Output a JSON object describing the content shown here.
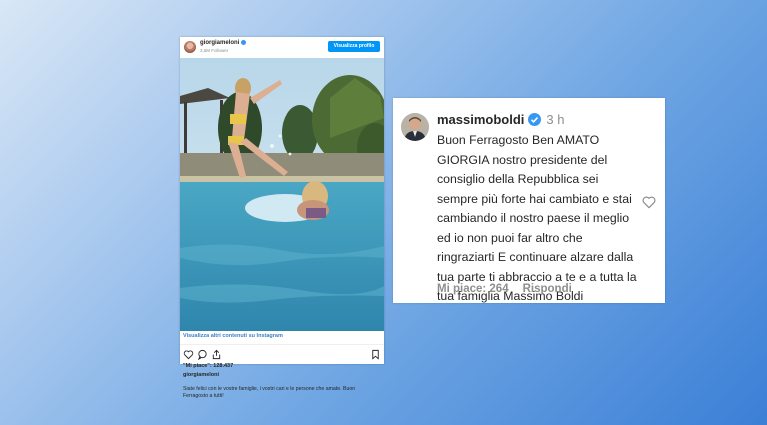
{
  "post": {
    "username": "giorgiameloni",
    "followers": "3,6M Follower",
    "view_profile": "Visualizza profilo",
    "view_more": "Visualizza altri contenuti su Instagram",
    "likes": "\"Mi piace\": 128.437",
    "owner": "giorgiameloni",
    "caption": "Siate felici con le vostre famiglie, i vostri cari e le persone che amate. Buon Ferragosto a tutti!",
    "icons": [
      "heart-icon",
      "comment-icon",
      "share-icon",
      "bookmark-icon"
    ]
  },
  "comment": {
    "username": "massimoboldi",
    "time": "3 h",
    "text": "Buon Ferragosto Ben AMATO GIORGIA nostro presidente del consiglio della Repubblica sei sempre più forte hai cambiato e stai cambiando il nostro paese il meglio ed io non puoi far altro che ringraziarti E continuare alzare dalla tua parte ti abbraccio a te e a tutta la tua famiglia Massimo Boldi",
    "likes": "Mi piace: 264",
    "reply": "Rispondi"
  },
  "colors": {
    "accent": "#0095f6",
    "verified": "#3897f0",
    "link": "#3d7fc7",
    "muted": "#8e8e8e",
    "text": "#262626"
  }
}
